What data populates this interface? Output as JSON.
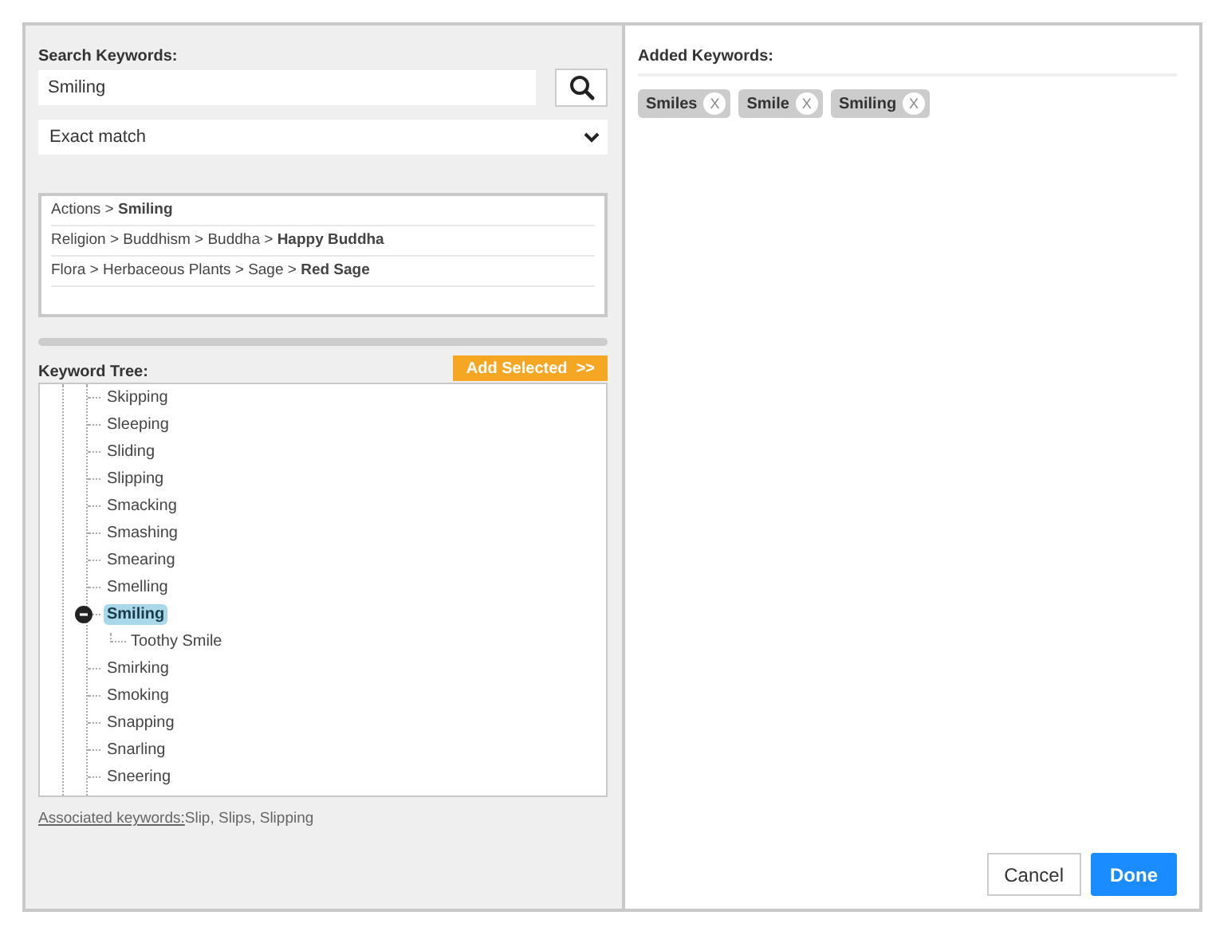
{
  "search": {
    "label": "Search Keywords:",
    "value": "Smiling"
  },
  "match_mode": {
    "value": "Exact match"
  },
  "results": [
    "Actions > **Smiling**",
    "Religion > Buddhism > Buddha > **Happy Buddha**",
    "Flora > Herbaceous Plants > Sage > **Red Sage**"
  ],
  "keyword_tree": {
    "label": "Keyword Tree:",
    "add_button": "Add Selected  >>",
    "items": [
      {
        "label": "Skipping",
        "selected": false,
        "expanded": false
      },
      {
        "label": "Sleeping",
        "selected": false,
        "expanded": false
      },
      {
        "label": "Sliding",
        "selected": false,
        "expanded": false
      },
      {
        "label": "Slipping",
        "selected": false,
        "expanded": false
      },
      {
        "label": "Smacking",
        "selected": false,
        "expanded": false
      },
      {
        "label": "Smashing",
        "selected": false,
        "expanded": false
      },
      {
        "label": "Smearing",
        "selected": false,
        "expanded": false
      },
      {
        "label": "Smelling",
        "selected": false,
        "expanded": false
      },
      {
        "label": "Smiling",
        "selected": true,
        "expanded": true,
        "children": [
          {
            "label": "Toothy Smile",
            "selected": false,
            "expanded": false
          }
        ]
      },
      {
        "label": "Smirking",
        "selected": false,
        "expanded": false
      },
      {
        "label": "Smoking",
        "selected": false,
        "expanded": false
      },
      {
        "label": "Snapping",
        "selected": false,
        "expanded": false
      },
      {
        "label": "Snarling",
        "selected": false,
        "expanded": false
      },
      {
        "label": "Sneering",
        "selected": false,
        "expanded": false
      }
    ]
  },
  "associated": {
    "link": "Associated keywords:",
    "value": "Slip, Slips, Slipping"
  },
  "added": {
    "label": "Added Keywords:",
    "chips": [
      {
        "label": "Smiles",
        "remove": "X"
      },
      {
        "label": "Smile",
        "remove": "X"
      },
      {
        "label": "Smiling",
        "remove": "X"
      }
    ]
  },
  "buttons": {
    "cancel": "Cancel",
    "done": "Done"
  }
}
